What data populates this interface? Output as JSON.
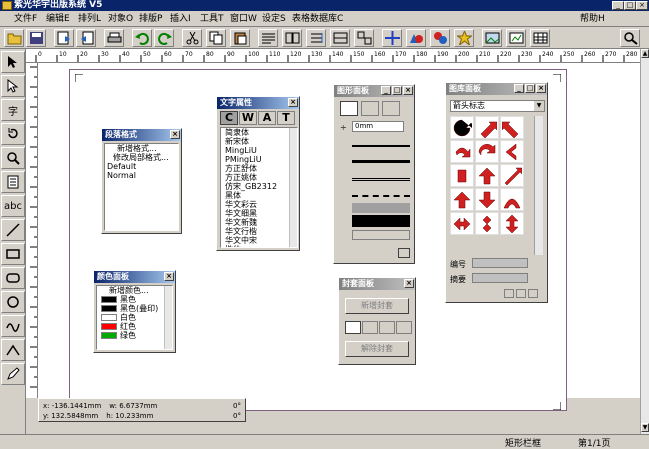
{
  "window": {
    "title": "紫光华宇出版系统 V5",
    "help": "帮助H",
    "controls": [
      "_",
      "□",
      "×"
    ]
  },
  "menu": [
    "文件F",
    "编辑E",
    "排列L",
    "对象O",
    "排版P",
    "插入I",
    "工具T",
    "窗口W",
    "设定S",
    "表格数据库C"
  ],
  "toolbar_icons": [
    "new-icon",
    "save-icon",
    "import-icon",
    "export-icon",
    "print-icon",
    "undo-icon",
    "redo-icon",
    "cut-icon",
    "copy-icon",
    "paste-icon",
    "text-flow-icon",
    "text-chain-icon",
    "link-frame-icon",
    "frame-icon",
    "group-icon",
    "move-icon",
    "shapes-icon",
    "color-icon",
    "star-icon",
    "image-icon",
    "picture-icon",
    "table-icon",
    "zoom-icon"
  ],
  "tools": [
    "pointer-tool",
    "subselect-tool",
    "text-tool",
    "rotate-tool",
    "zoom-tool",
    "column-tool",
    "abc-text-tool",
    "line-tool",
    "rect-tool",
    "rounded-rect-tool",
    "ellipse-tool",
    "curve-tool",
    "polyline-tool",
    "pen-tool"
  ],
  "tool_labels": {
    "abc": "abc",
    "text": "字"
  },
  "ruler_labels": [
    "0",
    "10",
    "20",
    "30",
    "40",
    "50",
    "60",
    "70",
    "80",
    "90",
    "100",
    "110",
    "120",
    "130",
    "140",
    "150",
    "160",
    "170",
    "180",
    "190",
    "200",
    "210",
    "220",
    "230",
    "240",
    "250",
    "260",
    "270",
    "280",
    "290"
  ],
  "panels": {
    "paragraph": {
      "title": "段落格式",
      "items": [
        "新增格式...",
        "修改局部格式...",
        "Default",
        "Normal"
      ]
    },
    "font": {
      "title": "文字属性",
      "tabs": [
        "C",
        "W",
        "A",
        "T"
      ],
      "items": [
        "简隶体",
        "新宋体",
        "MingLiU",
        "PMingLiU",
        "方正舒体",
        "方正姚体",
        "仿宋_GB2312",
        "黑体",
        "华文彩云",
        "华文细黑",
        "华文新魏",
        "华文行楷",
        "华文中宋",
        "楷体..."
      ]
    },
    "color": {
      "title": "颜色面板",
      "items": [
        {
          "label": "新增颜色...",
          "color": ""
        },
        {
          "label": "黑色",
          "color": "#000000"
        },
        {
          "label": "黑色(叠印)",
          "color": "#000000"
        },
        {
          "label": "白色",
          "color": "#ffffff"
        },
        {
          "label": "红色",
          "color": "#ff0000"
        },
        {
          "label": "绿色",
          "color": "#00aa00"
        }
      ]
    },
    "graphics": {
      "title": "图形面板",
      "width_value": "0mm"
    },
    "seal": {
      "title": "封套面板",
      "new_button": "新增封套",
      "remove_button": "解除封套"
    },
    "library": {
      "title": "图库面板",
      "dropdown": "箭头标志",
      "field_number_label": "编号",
      "field_note_label": "摘要",
      "arrow_colors": [
        "#000000",
        "#d02020",
        "#d02020",
        "#d02020",
        "#d02020",
        "#d02020",
        "#d02020",
        "#d02020",
        "#d02020",
        "#d02020",
        "#d02020",
        "#d02020",
        "#d02020",
        "#d02020",
        "#d02020"
      ]
    }
  },
  "coords": {
    "x": "x: -136.1441mm",
    "y": "y: 132.5848mm",
    "w": "w: 6.6737mm",
    "h": "h: 10.233mm",
    "rot": "0°",
    "skew": "0°"
  },
  "status": {
    "mode": "矩形栏框",
    "page": "第1/1页"
  }
}
